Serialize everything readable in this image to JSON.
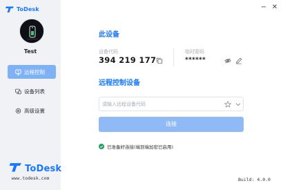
{
  "app": {
    "title": "ToDesk",
    "brand_color": "#1677ff"
  },
  "sidebar": {
    "username": "Test",
    "nav": [
      {
        "label": "远程控制",
        "icon": "monitor-icon",
        "active": true
      },
      {
        "label": "设备列表",
        "icon": "devices-icon",
        "active": false
      },
      {
        "label": "高级设置",
        "icon": "gear-icon",
        "active": false
      }
    ],
    "logo_text": "ToDesk",
    "website": "www.todesk.com"
  },
  "main": {
    "device_section_title": "此设备",
    "device_code_label": "设备代码",
    "device_code": "394 219 177",
    "temp_password_label": "临时密码",
    "temp_password": "******",
    "remote_section_title": "远程控制设备",
    "remote_input_placeholder": "请输入远程设备代码",
    "remote_input_value": "",
    "connect_label": "连接",
    "status_text": "已准备好连接(端到端加密已启用)",
    "status_color": "#22a35a",
    "build": "Build: 4.0.0"
  },
  "window_controls": {
    "minimize": "−",
    "close": "✕"
  }
}
